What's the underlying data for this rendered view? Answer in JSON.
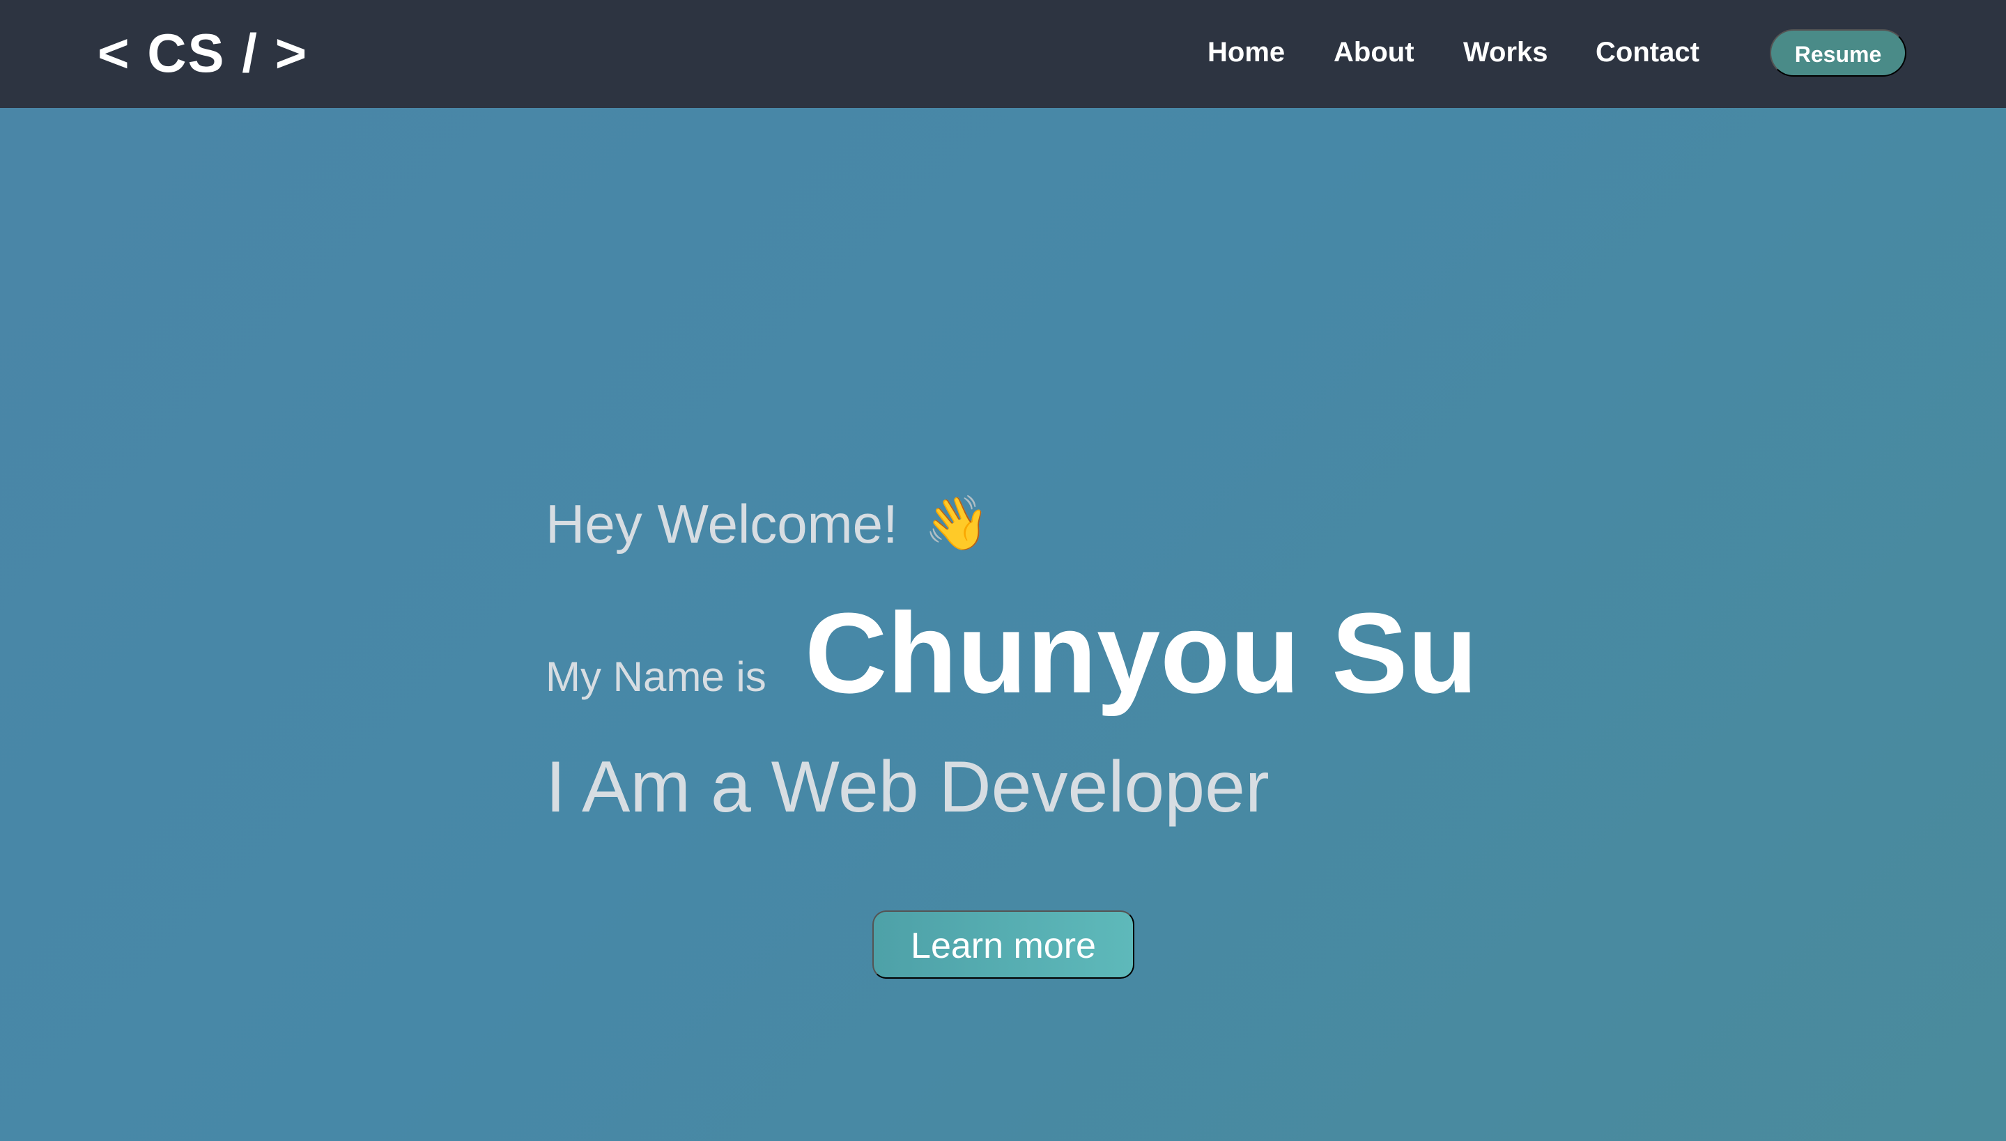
{
  "header": {
    "logo": "< CS / >",
    "nav": {
      "home": "Home",
      "about": "About",
      "works": "Works",
      "contact": "Contact"
    },
    "resume_label": "Resume"
  },
  "hero": {
    "greeting": "Hey Welcome!",
    "wave_icon": "👋",
    "name_intro": "My Name is",
    "name": "Chunyou Su",
    "role": "I Am a Web Developer",
    "cta_label": "Learn more"
  },
  "colors": {
    "navbar_background": "#2d3441",
    "hero_background": "#4a86a5",
    "resume_button": "#4a8b88",
    "cta_button": "#5eb9ba",
    "muted_text": "#d7dde2",
    "primary_text": "#ffffff"
  },
  "icons": {
    "wave": "waving-hand-icon"
  }
}
